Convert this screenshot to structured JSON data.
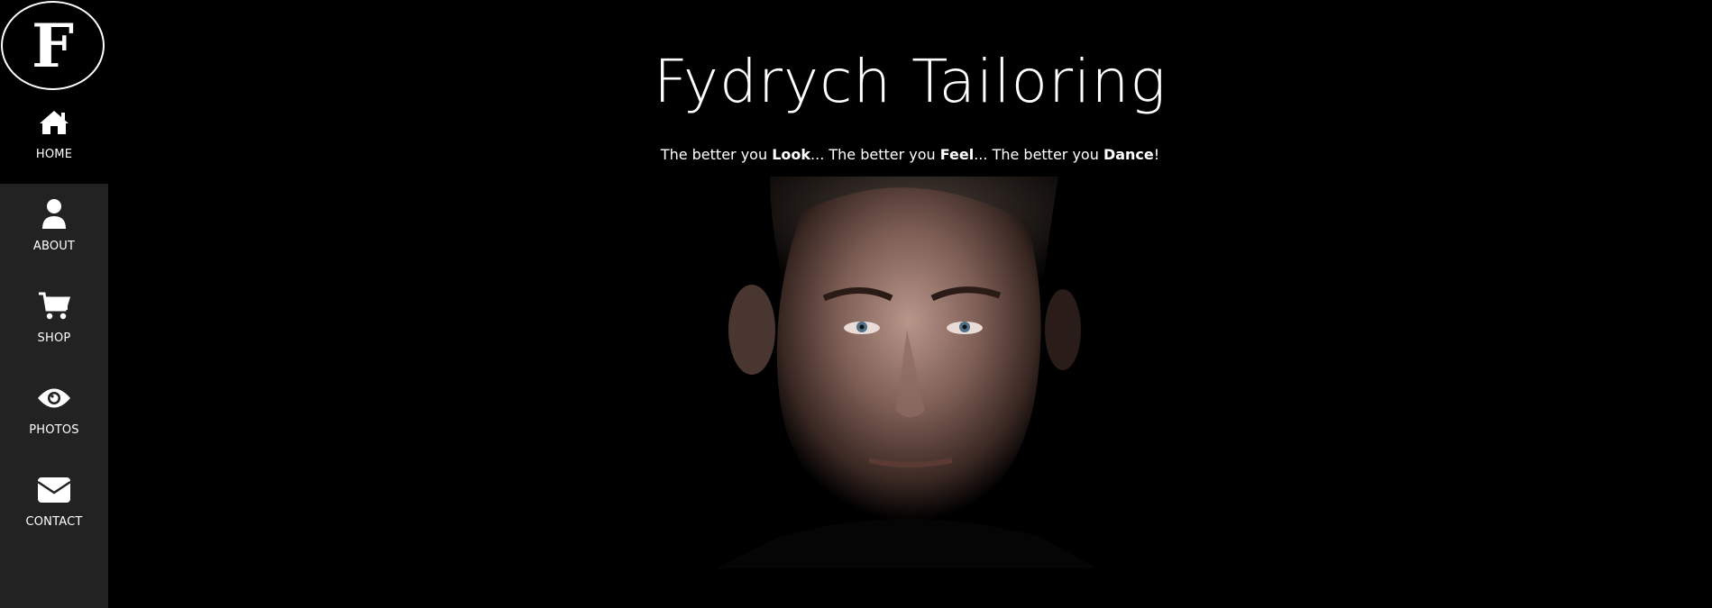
{
  "brand": {
    "logo_letter": "F"
  },
  "nav": {
    "items": [
      {
        "label": "HOME",
        "icon": "home-icon",
        "active": true
      },
      {
        "label": "ABOUT",
        "icon": "user-icon",
        "active": false
      },
      {
        "label": "SHOP",
        "icon": "cart-icon",
        "active": false
      },
      {
        "label": "PHOTOS",
        "icon": "eye-icon",
        "active": false
      },
      {
        "label": "CONTACT",
        "icon": "envelope-icon",
        "active": false
      }
    ]
  },
  "main": {
    "title": "Fydrych Tailoring",
    "tagline": {
      "p1": "The better you ",
      "b1": "Look",
      "p2": "... The better you ",
      "b2": "Feel",
      "p3": "... The better you ",
      "b3": "Dance",
      "p4": "!"
    },
    "portrait_alt": "portrait-photo"
  },
  "colors": {
    "background": "#000000",
    "sidebar": "#222222",
    "text": "#ffffff"
  }
}
